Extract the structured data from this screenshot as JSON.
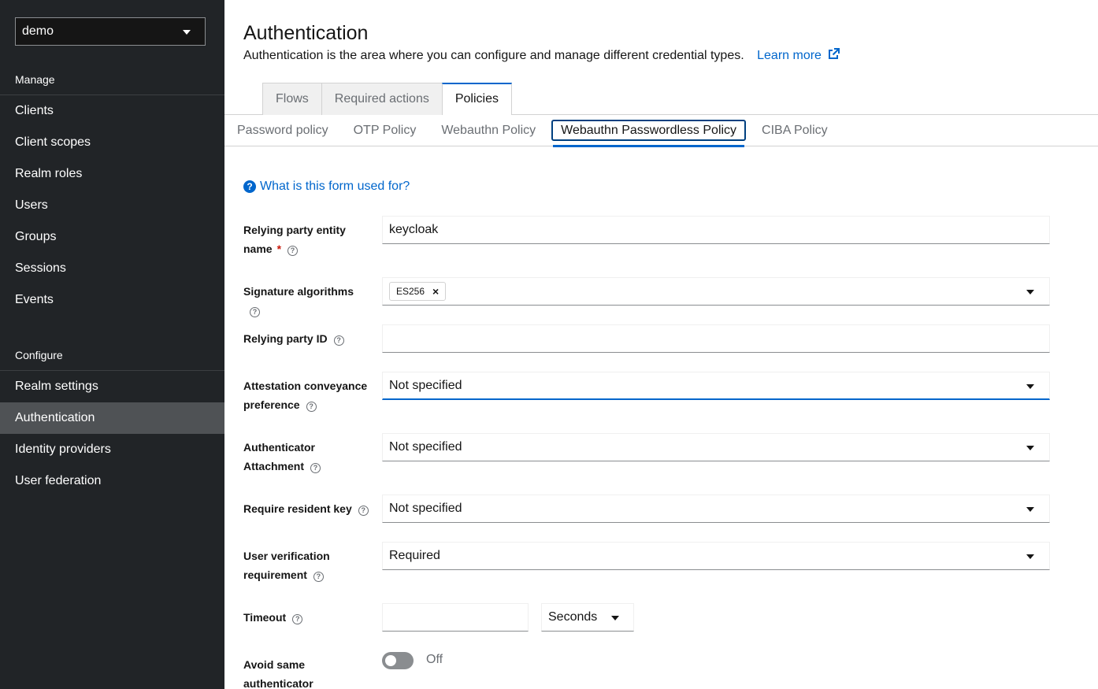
{
  "realm": {
    "selected": "demo"
  },
  "sidebar": {
    "manage_title": "Manage",
    "manage_items": [
      "Clients",
      "Client scopes",
      "Realm roles",
      "Users",
      "Groups",
      "Sessions",
      "Events"
    ],
    "configure_title": "Configure",
    "configure_items": [
      "Realm settings",
      "Authentication",
      "Identity providers",
      "User federation"
    ],
    "active_item": "Authentication"
  },
  "header": {
    "title": "Authentication",
    "description": "Authentication is the area where you can configure and manage different credential types.",
    "learn_more": "Learn more"
  },
  "tabs": [
    "Flows",
    "Required actions",
    "Policies"
  ],
  "active_tab": "Policies",
  "subtabs": [
    "Password policy",
    "OTP Policy",
    "Webauthn Policy",
    "Webauthn Passwordless Policy",
    "CIBA Policy"
  ],
  "active_subtab": "Webauthn Passwordless Policy",
  "help_link": "What is this form used for?",
  "form": {
    "rp_entity_name": {
      "label_line1": "Relying party entity",
      "label_line2": "name",
      "value": "keycloak"
    },
    "signature_algorithms": {
      "label": "Signature algorithms",
      "chip": "ES256"
    },
    "rp_id": {
      "label": "Relying party ID",
      "value": ""
    },
    "attestation": {
      "label_line1": "Attestation conveyance",
      "label_line2": "preference",
      "value": "Not specified"
    },
    "attachment": {
      "label_line1": "Authenticator",
      "label_line2": "Attachment",
      "value": "Not specified"
    },
    "resident_key": {
      "label": "Require resident key",
      "value": "Not specified"
    },
    "user_verification": {
      "label_line1": "User verification",
      "label_line2": "requirement",
      "value": "Required"
    },
    "timeout": {
      "label": "Timeout",
      "value": "",
      "unit": "Seconds"
    },
    "avoid_same": {
      "label_line1": "Avoid same",
      "label_line2": "authenticator",
      "toggle": "Off"
    }
  },
  "colors": {
    "sidebar_bg": "#212427",
    "active_nav": "#4f5255",
    "link": "#0066cc",
    "required": "#c9190b"
  }
}
